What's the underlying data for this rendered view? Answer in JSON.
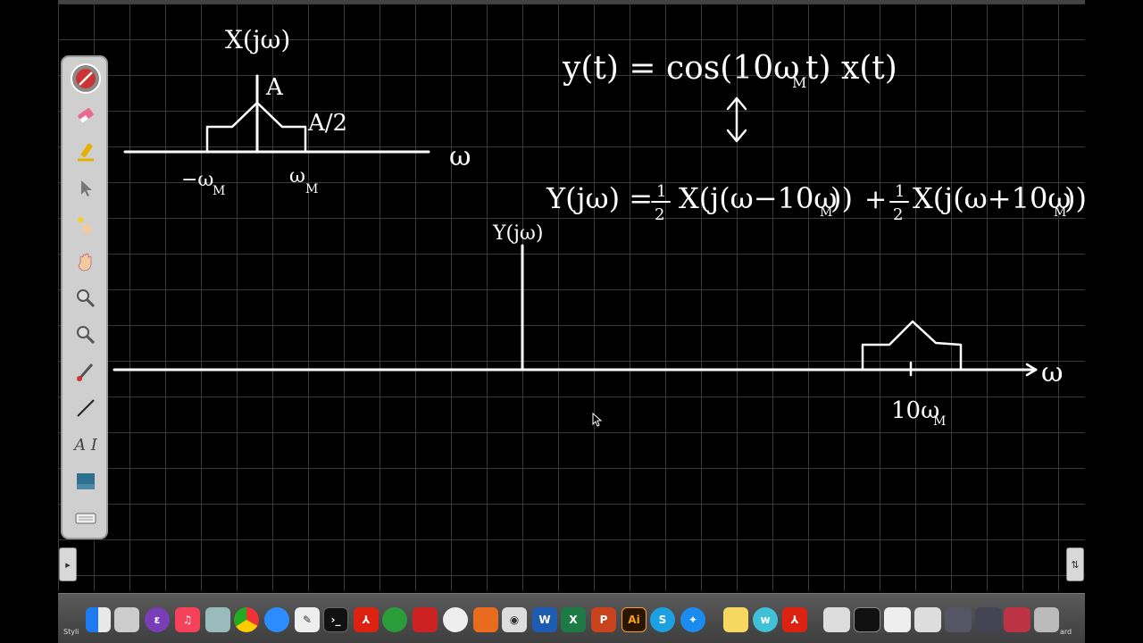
{
  "whiteboard": {
    "eq_top": "y(t) = cos(10ω",
    "eq_top_sub": "M",
    "eq_top_end": "t) x(t)",
    "arrow": "↕",
    "eq_main_lhs": "Y(jω) =",
    "half": "1",
    "half_den": "2",
    "term1": "X(j(ω−10ω",
    "term1_sub": "M",
    "term1_end": "))",
    "plus": "+",
    "term2": "X(j(ω+10ω",
    "term2_sub": "M",
    "term2_end": "))",
    "top_label": "X(jω)",
    "peak_label": "A",
    "half_label": "A/2",
    "omega_axis": "ω",
    "neg_omega_m": "−ω",
    "pos_omega_m": "ω",
    "sub_m": "M",
    "y_label": "Y(jω)",
    "ten_omega_m": "10ω",
    "ten_sub": "M"
  },
  "toolbar": {
    "tools": [
      {
        "name": "pen",
        "active": true
      },
      {
        "name": "eraser"
      },
      {
        "name": "highlighter"
      },
      {
        "name": "pointer"
      },
      {
        "name": "laser"
      },
      {
        "name": "hand"
      },
      {
        "name": "zoom-in"
      },
      {
        "name": "zoom-out"
      },
      {
        "name": "brush"
      },
      {
        "name": "line"
      },
      {
        "name": "text",
        "label": "A I"
      },
      {
        "name": "background"
      },
      {
        "name": "keyboard"
      }
    ],
    "collapse_label": "Styli"
  },
  "dock": {
    "label_right": "ard",
    "apps": [
      "Finder",
      "Launchpad",
      "Emacs",
      "Music",
      "Preview",
      "Chrome",
      "Zoom",
      "TextEdit",
      "Terminal",
      "Acrobat",
      "Evernote",
      "Photo Booth",
      "Mail",
      "MATLAB",
      "Screenshot",
      "Word",
      "Excel",
      "PowerPoint",
      "Illustrator",
      "Skype",
      "Safari",
      "Notes",
      "Whiteboard",
      "Acrobat Reader",
      "Trash"
    ],
    "word_letter": "W",
    "excel_letter": "X",
    "ppt_letter": "P",
    "ai_letter": "Ai",
    "skype_letter": "S"
  }
}
